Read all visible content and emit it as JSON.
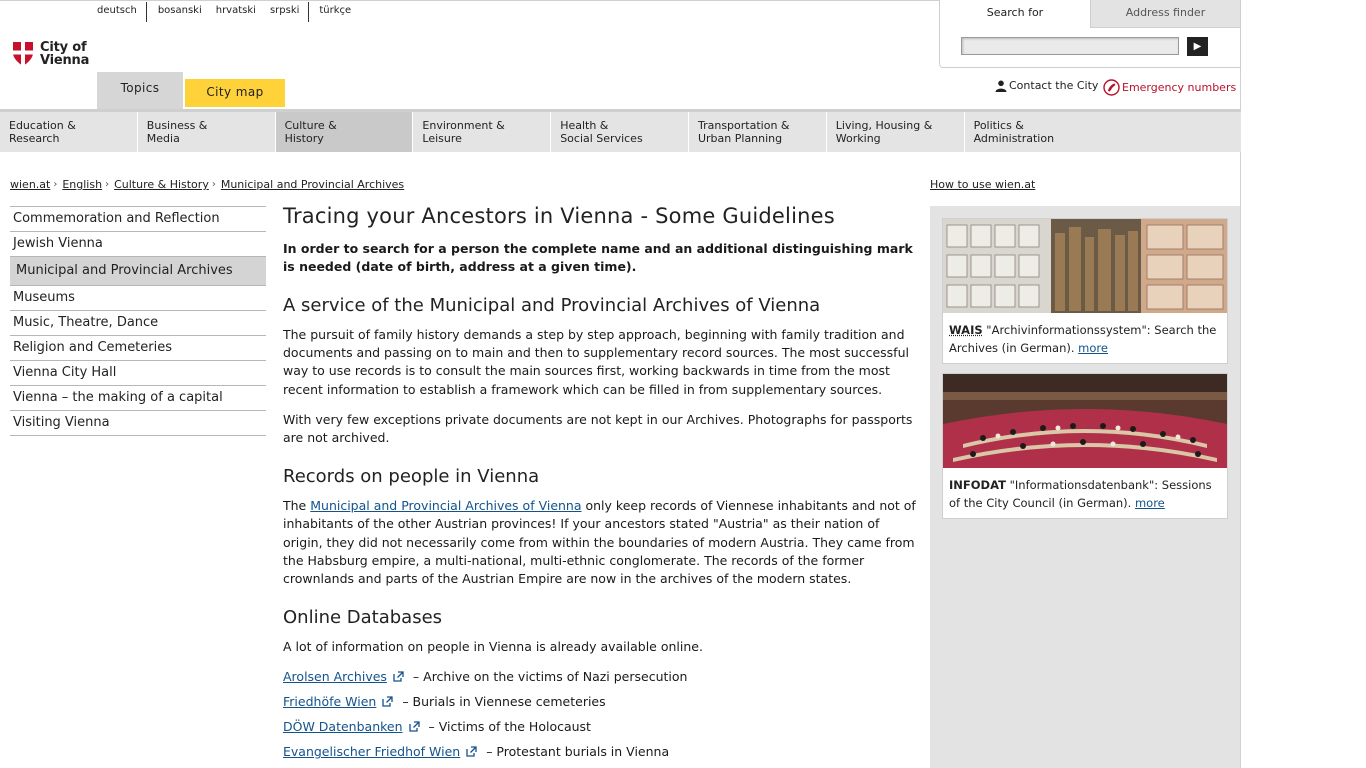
{
  "languages": [
    "deutsch",
    "bosanski",
    "hrvatski",
    "srpski",
    "türkçe"
  ],
  "logo": {
    "line1": "City of",
    "line2": "Vienna"
  },
  "tabs": {
    "topics": "Topics",
    "city_map": "City map"
  },
  "search": {
    "tab_search": "Search for",
    "tab_address": "Address finder",
    "placeholder": "",
    "button": "▶"
  },
  "contact": {
    "contact_label": "Contact the City",
    "emergency_label": "Emergency numbers"
  },
  "nav": [
    {
      "line1": "Education &",
      "line2": "Research"
    },
    {
      "line1": "Business &",
      "line2": "Media"
    },
    {
      "line1": "Culture &",
      "line2": "History"
    },
    {
      "line1": "Environment &",
      "line2": "Leisure"
    },
    {
      "line1": "Health &",
      "line2": "Social Services"
    },
    {
      "line1": "Transportation &",
      "line2": "Urban Planning"
    },
    {
      "line1": "Living, Housing &",
      "line2": "Working"
    },
    {
      "line1": "Politics &",
      "line2": "Administration"
    }
  ],
  "breadcrumb": [
    "wien.at",
    "English",
    "Culture & History",
    "Municipal and Provincial Archives"
  ],
  "howto": "How to use wien.at",
  "sidebar": [
    "Commemoration and Reflection",
    "Jewish Vienna",
    "Municipal and Provincial Archives",
    "Museums",
    "Music, Theatre, Dance",
    "Religion and Cemeteries",
    "Vienna City Hall",
    "Vienna – the making of a capital",
    "Visiting Vienna"
  ],
  "content": {
    "title": "Tracing your Ancestors in Vienna - Some Guidelines",
    "lead": "In order to search for a person the complete name and an additional distinguishing mark is needed (date of birth, address at a given time).",
    "h2_service": "A service of the Municipal and Provincial Archives of Vienna",
    "p_service": "The pursuit of family history demands a step by step approach, beginning with family tradition and documents and passing on to main and then to supplementary record sources. The most successful way to use records is to consult the main sources first, working backwards in time from the most recent information to establish a framework which can be filled in from supplementary sources.",
    "p_exceptions": "With very few exceptions private documents are not kept in our Archives. Photographs for passports are not archived.",
    "h2_records": "Records on people in Vienna",
    "p_records_pre": "The ",
    "p_records_link": "Municipal and Provincial Archives of Vienna",
    "p_records_post": " only keep records of Viennese inhabitants and not of inhabitants of the other Austrian provinces! If your ancestors stated \"Austria\" as their nation of origin, they did not necessarily come from within the boundaries of modern Austria. They came from the Habsburg empire, a multi-national, multi-ethnic conglomerate. The records of the former crownlands and parts of the Austrian Empire are now in the archives of the modern states.",
    "h2_online": "Online Databases",
    "p_online": "A lot of information on people in Vienna is already available online.",
    "databases": [
      {
        "name": "Arolsen Archives",
        "desc": "– Archive on the victims of Nazi persecution"
      },
      {
        "name": "Friedhöfe Wien",
        "desc": "– Burials in Viennese cemeteries"
      },
      {
        "name": "DÖW Datenbanken",
        "desc": "– Victims of the Holocaust"
      },
      {
        "name": "Evangelischer Friedhof Wien",
        "desc": "– Protestant burials in Vienna"
      }
    ]
  },
  "teasers": [
    {
      "abbr": "WAIS",
      "text": " \"Archivinformationssystem\": Search the Archives (in German). ",
      "more": "more"
    },
    {
      "abbr": "INFODAT",
      "text": " \"Informationsdatenbank\": Sessions of the City Council (in German). ",
      "more": "more"
    }
  ],
  "colors": {
    "accent_yellow": "#ffd23a",
    "link": "#14528c",
    "emergency": "#b8122b",
    "logo_red": "#c8102e"
  }
}
